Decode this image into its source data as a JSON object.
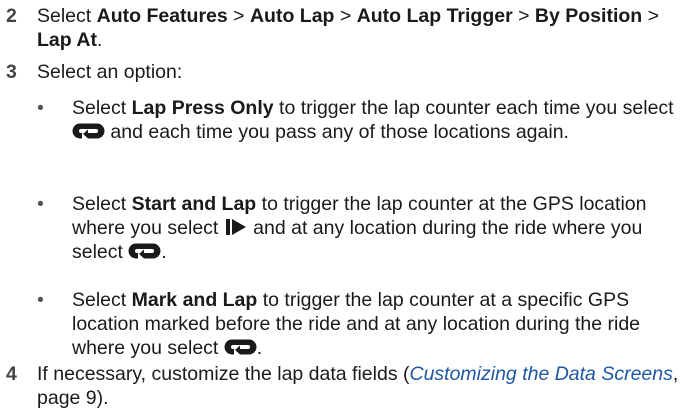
{
  "steps": [
    {
      "number": "2",
      "parts": {
        "select": "Select ",
        "auto_features": "Auto Features",
        "sep1": " > ",
        "auto_lap": "Auto Lap",
        "sep2": " > ",
        "auto_lap_trigger": "Auto Lap Trigger",
        "sep3": " > ",
        "by_position": "By Position",
        "sep4": " > ",
        "lap_at": "Lap At",
        "end": "."
      }
    },
    {
      "number": "3",
      "text": "Select an option:"
    },
    {
      "number": "4",
      "before": "If necessary, customize the lap data fields (",
      "link": "Customizing the Data Screens",
      "after": ", page 9)."
    }
  ],
  "options": [
    {
      "bullet": "•",
      "select": "Select ",
      "name": "Lap Press Only",
      "text_a": " to trigger the lap counter each time you select ",
      "icon_a": "lap-icon",
      "text_b": " and each time you pass any of those locations again."
    },
    {
      "bullet": "•",
      "select": "Select ",
      "name": "Start and Lap",
      "text_a": " to trigger the lap counter at the GPS location where you select ",
      "icon_a": "start-icon",
      "text_b": " and at any location during the ride where you select ",
      "icon_b": "lap-icon",
      "text_c": "."
    },
    {
      "bullet": "•",
      "select": "Select ",
      "name": "Mark and Lap",
      "text_a": " to trigger the lap counter at a specific GPS location marked before the ride and at any location during the ride where you select ",
      "icon_a": "lap-icon",
      "text_b": "."
    }
  ],
  "colors": {
    "text": "#1a1a1a",
    "link": "#1f57a4",
    "step_number": "#444444"
  }
}
